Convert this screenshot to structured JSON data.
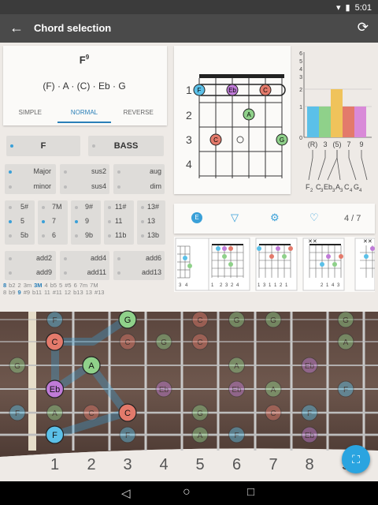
{
  "status": {
    "time": "5:01"
  },
  "appbar": {
    "title": "Chord selection",
    "back_icon": "arrow-left-icon",
    "refresh_icon": "refresh-icon"
  },
  "chord": {
    "name": "F",
    "superscript": "9",
    "notes": "(F) · A · (C) · Eb · G"
  },
  "mode_tabs": [
    "SIMPLE",
    "NORMAL",
    "REVERSE"
  ],
  "mode_selected": "NORMAL",
  "root_button": "F",
  "bass_button": "BASS",
  "qualities": [
    [
      "Major",
      "minor"
    ],
    [
      "sus2",
      "sus4"
    ],
    [
      "aug",
      "dim"
    ]
  ],
  "extensions": [
    [
      "5#",
      "5",
      "5b"
    ],
    [
      "7M",
      "7",
      "6"
    ],
    [
      "9#",
      "9",
      "9b"
    ],
    [
      "11#",
      "11",
      "11b"
    ],
    [
      "13#",
      "13",
      "13b"
    ]
  ],
  "adds": [
    [
      "add2",
      "add9"
    ],
    [
      "add4",
      "add11"
    ],
    [
      "add6",
      "add13"
    ]
  ],
  "interval_row1": [
    "8",
    "b2",
    "2",
    "3m",
    "3M",
    "4",
    "b5",
    "5",
    "#5",
    "6",
    "7m",
    "7M"
  ],
  "interval_row2": [
    "8",
    "b9",
    "9",
    "#9",
    "b11",
    "11",
    "#11",
    "12",
    "b13",
    "13",
    "#13"
  ],
  "diagram": {
    "frets": [
      "1",
      "2",
      "3",
      "4"
    ],
    "notes": {
      "F": "F",
      "Eb": "Eb",
      "C": "C",
      "A": "A",
      "C2": "C",
      "G": "G"
    }
  },
  "histogram": {
    "yticks": [
      "6",
      "5",
      "4",
      "3",
      "2",
      "1",
      "0"
    ],
    "labels": [
      "(R)",
      "3",
      "(5)",
      "7",
      "9"
    ],
    "notes": [
      "F",
      "C",
      "Eb",
      "A",
      "C",
      "G"
    ],
    "octaves": [
      "2",
      "3",
      "3",
      "3",
      "4",
      "4"
    ],
    "colors": [
      "#5bc0e8",
      "#8fd18a",
      "#f0c35b",
      "#e37a6b",
      "#d98ad8"
    ]
  },
  "toolbar": {
    "page": "4 / 7",
    "icons": [
      "e-badge-icon",
      "filter-icon",
      "settings-icon",
      "heart-icon"
    ]
  },
  "thumbnails": [
    [
      "3",
      "4"
    ],
    [
      "1",
      "2",
      "3",
      "2",
      "4"
    ],
    [
      "1",
      "3",
      "1",
      "1",
      "2",
      "1"
    ],
    [
      "2",
      "1",
      "4",
      "3"
    ],
    [
      ""
    ]
  ],
  "fretboard": {
    "fret_numbers": [
      "1",
      "2",
      "3",
      "4",
      "5",
      "6",
      "7",
      "8",
      "9"
    ],
    "fingered": [
      {
        "n": "G"
      },
      {
        "n": "C"
      },
      {
        "n": "A"
      },
      {
        "n": "Eb"
      },
      {
        "n": "C"
      },
      {
        "n": "F"
      }
    ],
    "ghost": [
      "F",
      "C",
      "G",
      "A",
      "C",
      "G",
      "Eb",
      "F",
      "C",
      "A",
      "Eb",
      "F",
      "C",
      "G",
      "A",
      "Eb",
      "F",
      "G",
      "A",
      "C",
      "G",
      "Eb",
      "F",
      "A",
      "C",
      "F",
      "A",
      "G"
    ]
  },
  "fab_icon": "fullscreen-icon",
  "nav": {
    "back": "◁",
    "home": "○",
    "recent": "□"
  }
}
